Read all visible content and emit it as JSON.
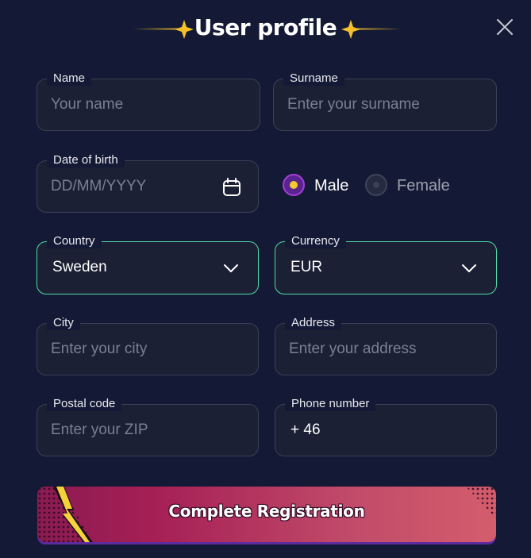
{
  "header": {
    "title": "User profile",
    "icons": {
      "decoration": "sparkle-icon",
      "close": "close-icon"
    }
  },
  "form": {
    "name": {
      "label": "Name",
      "placeholder": "Your name",
      "value": ""
    },
    "surname": {
      "label": "Surname",
      "placeholder": "Enter your surname",
      "value": ""
    },
    "date_of_birth": {
      "label": "Date of birth",
      "placeholder": "DD/MM/YYYY",
      "value": "",
      "icon": "calendar-icon"
    },
    "gender": {
      "options": [
        {
          "label": "Male",
          "selected": true
        },
        {
          "label": "Female",
          "selected": false
        }
      ]
    },
    "country": {
      "label": "Country",
      "value": "Sweden",
      "icon": "chevron-down-icon"
    },
    "currency": {
      "label": "Currency",
      "value": "EUR",
      "icon": "chevron-down-icon"
    },
    "city": {
      "label": "City",
      "placeholder": "Enter your city",
      "value": ""
    },
    "address": {
      "label": "Address",
      "placeholder": "Enter your address",
      "value": ""
    },
    "postal_code": {
      "label": "Postal code",
      "placeholder": "Enter your ZIP",
      "value": ""
    },
    "phone_number": {
      "label": "Phone number",
      "prefix": "+ 46",
      "value": ""
    }
  },
  "submit": {
    "label": "Complete Registration"
  },
  "colors": {
    "background": "#141a35",
    "field_border": "#3a4056",
    "active_border": "#4fdca8",
    "radio_selected": "#a53cd8",
    "radio_dot": "#f5c82e",
    "cta_start": "#8a1b52",
    "cta_end": "#d45d6c",
    "sparkle": "#f5c02a"
  }
}
